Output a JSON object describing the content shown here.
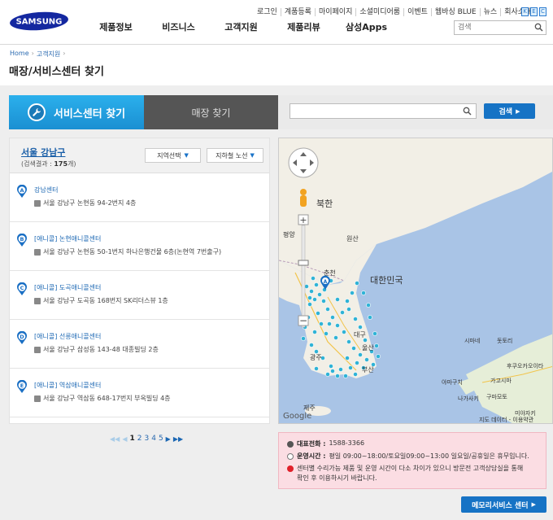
{
  "brand": {
    "logo_text": "SAMSUNG",
    "color": "#1428a0"
  },
  "utility_links": [
    "로그인",
    "계품등록",
    "마이페이지",
    "소셜미디어룸",
    "이벤트",
    "웹바싱 BLUE",
    "뉴스",
    "회사소개"
  ],
  "lang_boxes": [
    "K",
    "E",
    "C"
  ],
  "gnb": [
    "제품정보",
    "비즈니스",
    "고객지원",
    "제품리뷰",
    "삼성Apps"
  ],
  "header_search": {
    "placeholder": "검색"
  },
  "breadcrumb": [
    "Home",
    "고객지원"
  ],
  "page_title": "매장/서비스센터 찾기",
  "tabs": {
    "service_center": "서비스센터 찾기",
    "store": "매장 찾기"
  },
  "search": {
    "button_label": "검색"
  },
  "list": {
    "region": "서울 강남구",
    "count_prefix": "(검색결과 :",
    "count_value": "175",
    "count_suffix": "개)",
    "region_select": "지역선택",
    "subway_select": "지하철 노선",
    "items": [
      {
        "marker": "A",
        "name": "강남센터",
        "address": "서울 강남구 논현동 94-2번지 4층"
      },
      {
        "marker": "B",
        "name": "[애니콜] 논현애니콜센터",
        "address": "서울 강남구 논현동 50-1번지 하나은행건물 6층(논현역 7번출구)"
      },
      {
        "marker": "C",
        "name": "[애니콜] 도곡애니콜센터",
        "address": "서울 강남구 도곡동 168번지 SK리더스뷰 1층"
      },
      {
        "marker": "D",
        "name": "[애니콜] 선릉애니콜센터",
        "address": "서울 강남구 삼성동 143-48 대종빌딩 2층"
      },
      {
        "marker": "E",
        "name": "[애니콜] 역삼애니콜센터",
        "address": "서울 강남구 역삼동 648-17번지 부옥빌딩 4층"
      }
    ]
  },
  "pager": {
    "pages": [
      "1",
      "2",
      "3",
      "4",
      "5"
    ],
    "current": "1"
  },
  "map": {
    "labels": {
      "north_korea": "북한",
      "pyongyang": "평양",
      "wonsan": "원산",
      "chuncheon": "춘천",
      "south_korea": "대한민국",
      "ulsan": "울산",
      "gwangju": "광주",
      "daegu": "대구",
      "busan": "부산",
      "jeju": "제주",
      "yamaguchi": "야마구치",
      "fukuoka": "후쿠오카",
      "oita": "오이타",
      "kumamoto": "구마모토",
      "miyazaki": "미야자키",
      "kagoshima": "가고시마",
      "nagasaki": "나가사키",
      "shimane": "시마네",
      "tottori": "돗토리"
    },
    "attribution": "지도 데이터 - 이용약관",
    "google": "Google"
  },
  "info": {
    "phone_label": "대표전화 :",
    "phone": "1588-3366",
    "hours_label": "운영시간 :",
    "hours": "평일 09:00~18:00/토요일09:00~13:00 일요일/공휴일은 휴무입니다.",
    "notice": "센터별 수리가능 제품 및 운영 시간이 다소 차이가 있으니 방문전 고객상담실을 통해 확인 후 이용하시기 바랍니다."
  },
  "memo_button": "메모리서비스 센터",
  "colors": {
    "accent": "#1673c5",
    "tab_active": "#1fa0e0",
    "tab_inactive": "#555555",
    "marker": "#2fb3d6"
  }
}
